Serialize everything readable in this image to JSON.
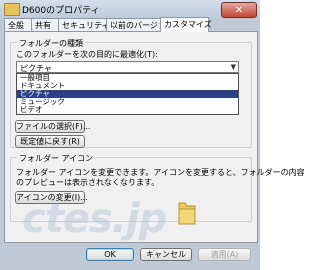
{
  "window": {
    "title": "D600のプロパティ",
    "close_label": "✕"
  },
  "tabs": [
    {
      "label": "全般"
    },
    {
      "label": "共有"
    },
    {
      "label": "セキュリティ"
    },
    {
      "label": "以前のバージョン"
    },
    {
      "label": "カスタマイズ",
      "active": true
    }
  ],
  "folder_type": {
    "group_title": "フォルダーの種類",
    "description": "このフォルダーを次の目的に最適化(T):",
    "selected_value": "ピクチャ",
    "options": [
      "一般項目",
      "ドキュメント",
      "ピクチャ",
      "ミュージック",
      "ビデオ"
    ],
    "selected_index": 2
  },
  "folder_picture": {
    "choose_file_label": "ファイルの選択(F)...",
    "restore_default_label": "既定値に戻す(R)"
  },
  "folder_icon": {
    "group_title": "フォルダー アイコン",
    "description_line1": "フォルダー アイコンを変更できます。アイコンを変更すると、フォルダーの内容",
    "description_line2": "のプレビューは表示されなくなります。",
    "change_icon_label": "アイコンの変更(I)..."
  },
  "footer": {
    "ok_label": "OK",
    "cancel_label": "キャンセル",
    "apply_label": "適用(A)"
  },
  "watermark": "ctes.jp",
  "colors": {
    "selection": "#2c3f84",
    "folder": "#e8c65a"
  }
}
